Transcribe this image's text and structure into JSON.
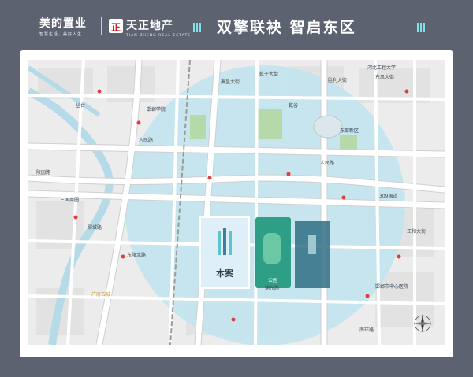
{
  "header": {
    "brand1_name": "美的置业",
    "brand1_sub": "智慧生活，美好人生",
    "brand2_logo_char": "正",
    "brand2_name": "天正地产",
    "brand2_sub": "TIAN ZHENG REAL ESTATE",
    "headline": "双擎联袂  智启东区"
  },
  "map": {
    "colors": {
      "circle": "#bfe4ee",
      "road": "#ffffff",
      "road_edge": "#cfcfcf",
      "project": "#dfeff8",
      "park": "#2e9e86",
      "river": "#b6dbe8",
      "red": "#d9413e",
      "gold": "#c79a32"
    },
    "roads": {
      "renmin": "人民路",
      "renmin2": "人民路",
      "g309": "309国道",
      "longyuan": "陵园路",
      "qinhuang": "秦皇大街",
      "qianzi": "乾子大街",
      "dongfeng": "东风大街",
      "shengli": "胜利大街",
      "dongling": "东陵北路",
      "zhenghe": "正和大街",
      "yuncheng": "郓城路",
      "pudong": "浦东路",
      "nanhuan": "南环路"
    },
    "places": {
      "project_label": "本案",
      "park_label": "公园",
      "guangfu": "广府古城",
      "sanguo": "三国商圈",
      "congtai": "丛台",
      "hebei_uni": "河北工程大学",
      "qiangu": "乾谷",
      "dongyuan": "东部新区",
      "school1": "邯郸学院",
      "hospital": "邯郸市中心医院"
    }
  }
}
